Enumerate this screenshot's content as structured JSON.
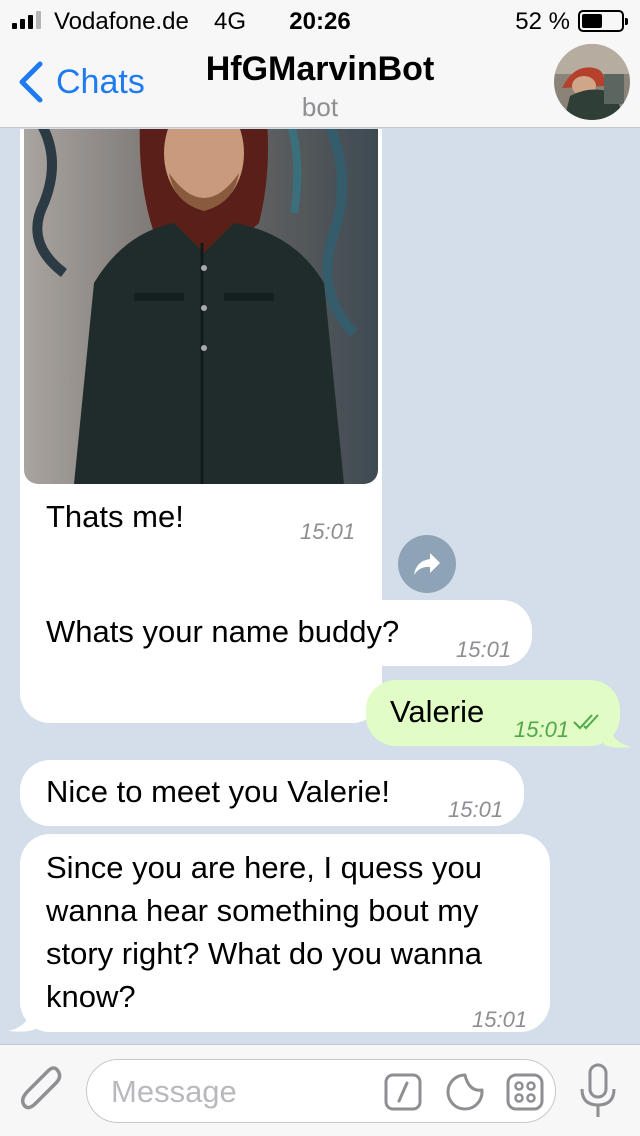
{
  "status_bar": {
    "carrier": "Vodafone.de",
    "network": "4G",
    "time": "20:26",
    "battery_percent": "52 %",
    "battery_level": 0.52,
    "signal_bars_filled": 3,
    "signal_bars_total": 4
  },
  "nav": {
    "back_label": "Chats",
    "title": "HfGMarvinBot",
    "subtitle": "bot"
  },
  "messages": {
    "m1": {
      "text": "Thats me!",
      "time": "15:01"
    },
    "m2": {
      "text": "Whats your name buddy?",
      "time": "15:01"
    },
    "m3": {
      "text": "Valerie",
      "time": "15:01"
    },
    "m4": {
      "text": "Nice to meet you Valerie!",
      "time": "15:01"
    },
    "m5": {
      "text": "Since you are here, I quess you wanna hear something bout my story right? What do you wanna know?",
      "time": "15:01"
    }
  },
  "input_bar": {
    "placeholder": "Message"
  },
  "colors": {
    "accent": "#1f7bf2",
    "chat_background": "#d3deea",
    "incoming_bubble": "#ffffff",
    "outgoing_bubble": "#e2fcc6",
    "outgoing_time": "#4fa84a",
    "share_button": "#8ea3b6"
  },
  "icons": [
    "back-chevron-icon",
    "forward-share-icon",
    "read-checkmarks-icon",
    "paperclip-icon",
    "slash-command-icon",
    "sticker-icon",
    "bot-keyboard-icon",
    "microphone-icon"
  ]
}
